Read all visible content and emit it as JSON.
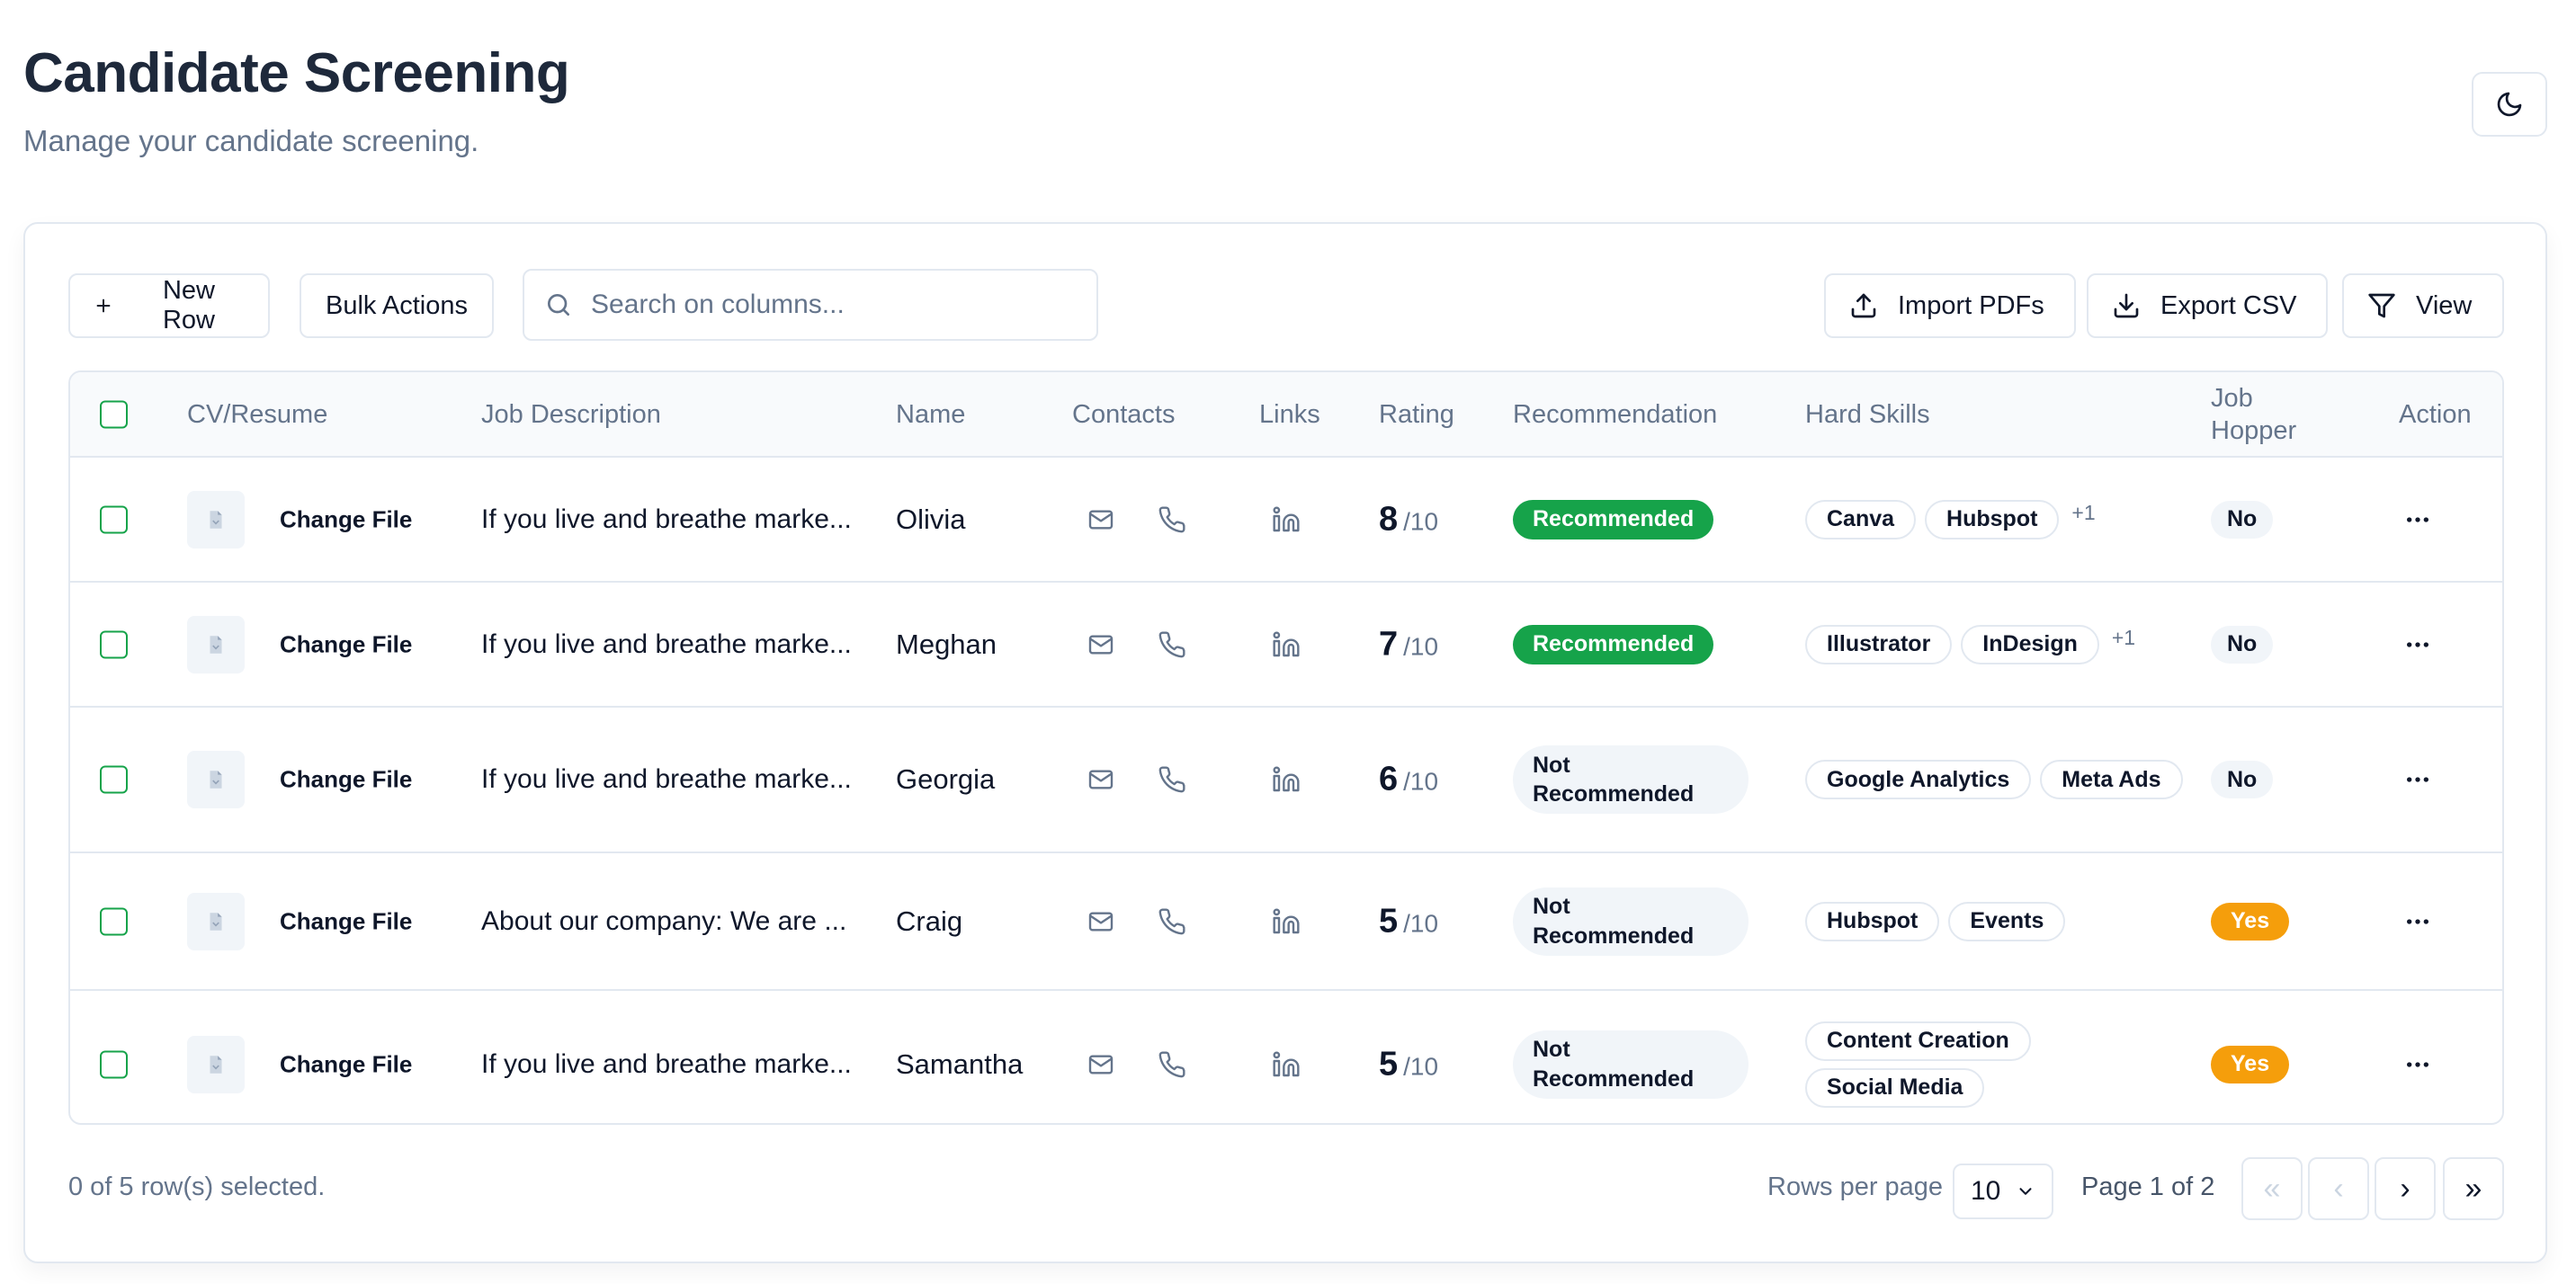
{
  "header": {
    "title": "Candidate Screening",
    "subtitle": "Manage your candidate screening."
  },
  "toolbar": {
    "new_row": "New Row",
    "bulk_actions": "Bulk Actions",
    "search_placeholder": "Search on columns...",
    "import_pdfs": "Import PDFs",
    "export_csv": "Export CSV",
    "view": "View"
  },
  "table": {
    "columns": {
      "cv": "CV/Resume",
      "job_description": "Job Description",
      "name": "Name",
      "contacts": "Contacts",
      "links": "Links",
      "rating": "Rating",
      "recommendation": "Recommendation",
      "hard_skills": "Hard Skills",
      "job_hopper_1": "Job",
      "job_hopper_2": "Hopper",
      "action": "Action"
    },
    "rows": [
      {
        "file_label": "Change File",
        "job_description": "If you live and breathe marke...",
        "name": "Olivia",
        "rating": "8",
        "rating_max": "/10",
        "recommendation_1": "Recommended",
        "recommendation_2": "",
        "recommended": true,
        "skills": [
          "Canva",
          "Hubspot"
        ],
        "skills_more": "+1",
        "job_hopper": "No"
      },
      {
        "file_label": "Change File",
        "job_description": "If you live and breathe marke...",
        "name": "Meghan",
        "rating": "7",
        "rating_max": "/10",
        "recommendation_1": "Recommended",
        "recommendation_2": "",
        "recommended": true,
        "skills": [
          "Illustrator",
          "InDesign"
        ],
        "skills_more": "+1",
        "job_hopper": "No"
      },
      {
        "file_label": "Change File",
        "job_description": "If you live and breathe marke...",
        "name": "Georgia",
        "rating": "6",
        "rating_max": "/10",
        "recommendation_1": "Not",
        "recommendation_2": "Recommended",
        "recommended": false,
        "skills": [
          "Google Analytics",
          "Meta Ads"
        ],
        "skills_more": "",
        "job_hopper": "No"
      },
      {
        "file_label": "Change File",
        "job_description": "About our company: We are ...",
        "name": "Craig",
        "rating": "5",
        "rating_max": "/10",
        "recommendation_1": "Not",
        "recommendation_2": "Recommended",
        "recommended": false,
        "skills": [
          "Hubspot",
          "Events"
        ],
        "skills_more": "",
        "job_hopper": "Yes"
      },
      {
        "file_label": "Change File",
        "job_description": "If you live and breathe marke...",
        "name": "Samantha",
        "rating": "5",
        "rating_max": "/10",
        "recommendation_1": "Not",
        "recommendation_2": "Recommended",
        "recommended": false,
        "skills": [
          "Content Creation",
          "Social Media"
        ],
        "skills_more": "",
        "job_hopper": "Yes"
      }
    ]
  },
  "footer": {
    "selection": "0 of 5 row(s) selected.",
    "rows_per_page_label": "Rows per page",
    "rows_per_page_value": "10",
    "page_info": "Page 1 of 2",
    "first": "«",
    "prev": "‹",
    "next": "›",
    "last": "»"
  },
  "colors": {
    "recommended": "#16a34a",
    "job_hopper_yes": "#f59e0b",
    "checkbox": "#16a34a",
    "muted_text": "#64748b",
    "border": "#e2e8f0"
  }
}
